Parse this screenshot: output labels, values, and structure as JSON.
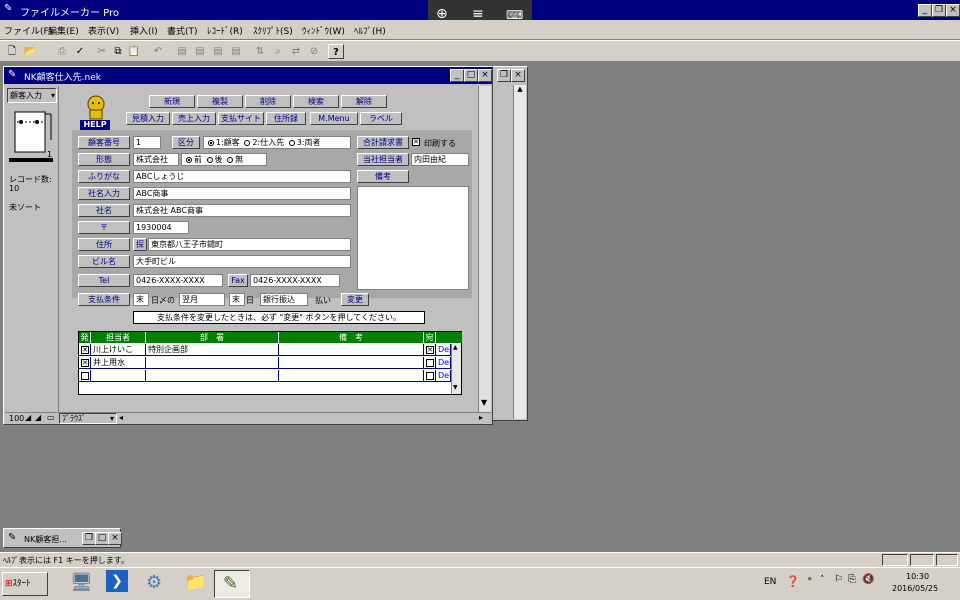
{
  "app": {
    "title": "ファイルメーカー Pro"
  },
  "menu": [
    "ファイル(F)",
    "編集(E)",
    "表示(V)",
    "挿入(I)",
    "書式(T)",
    "ﾚｺｰﾄﾞ(R)",
    "ｽｸﾘﾌﾟﾄ(S)",
    "ｳｨﾝﾄﾞｳ(W)",
    "ﾍﾙﾌﾟ(H)"
  ],
  "window": {
    "title": "NK顧客仕入先.nek"
  },
  "sidebar": {
    "mode": "顧客入力",
    "record_count_label": "レコード数:",
    "record_count": "10",
    "sort_status": "未ソート",
    "zoom": "100",
    "view_mode": "ﾌﾞﾗｳｽﾞ"
  },
  "help_logo": "HELP",
  "buttons_row1": [
    "新規",
    "複製",
    "削除",
    "検索",
    "解除"
  ],
  "buttons_row2": [
    "見積入力",
    "売上入力",
    "支払サイト",
    "住所録",
    "M.Menu",
    "ラベル"
  ],
  "form": {
    "customer_no_label": "顧客番号",
    "customer_no": "1",
    "kubun_label": "区分",
    "kubun_options": [
      "1:顧客",
      "2:仕入先",
      "3:両者"
    ],
    "kubun_selected": 0,
    "total_invoice_label": "合計請求書",
    "print_label": "印刷する",
    "print_checked": true,
    "keitai_label": "形態",
    "keitai": "株式会社",
    "keitai_pos_options": [
      "前",
      "後",
      "無"
    ],
    "keitai_pos_selected": 0,
    "tanto_label": "当社担当者",
    "tanto": "内田由紀",
    "furigana_label": "ふりがな",
    "furigana": "ABCしょうじ",
    "bikou_label": "備考",
    "shamei_input_label": "社名入力",
    "shamei_input": "ABC商事",
    "shamei_label": "社名",
    "shamei": "株式会社 ABC商事",
    "zip_label": "〒",
    "zip": "1930004",
    "address_label": "住所",
    "address_search": "探",
    "address": "東京都八王子市鑓町",
    "building_label": "ビル名",
    "building": "大手町ビル",
    "tel_label": "Tel",
    "tel": "0426-XXXX-XXXX",
    "fax_label": "Fax",
    "fax": "0426-XXXX-XXXX",
    "pay_label": "支払条件",
    "pay_close": "末",
    "pay_close_suffix": "日〆の",
    "pay_month": "翌月",
    "pay_day": "末",
    "pay_day_suffix": "日",
    "pay_method": "銀行振込",
    "pay_suffix": "払い",
    "change_button": "変更",
    "pay_notice": "支払条件を変更したときは、必ず \"変更\" ボタンを押してください。"
  },
  "portal": {
    "headers": [
      "発",
      "担当者",
      "部　署",
      "備　考",
      "宛"
    ],
    "rows": [
      {
        "hatsu": true,
        "name": "川上けいこ",
        "dept": "特別企画部",
        "note": "",
        "ate": true,
        "del": "Del"
      },
      {
        "hatsu": true,
        "name": "井上用水",
        "dept": "",
        "note": "",
        "ate": false,
        "del": "Del"
      },
      {
        "hatsu": false,
        "name": "",
        "dept": "",
        "note": "",
        "ate": false,
        "del": "Del"
      }
    ]
  },
  "minimized": {
    "title": "NK顧客担..."
  },
  "status_bar": "ﾍﾙﾌﾟ表示には F1 キーを押します。",
  "taskbar": {
    "start": "ｽﾀｰﾄ",
    "lang": "EN",
    "time": "10:30",
    "date": "2016/05/25"
  },
  "colors": {
    "title_blue": "#000080",
    "portal_green": "#008000",
    "label_text": "#000080"
  }
}
